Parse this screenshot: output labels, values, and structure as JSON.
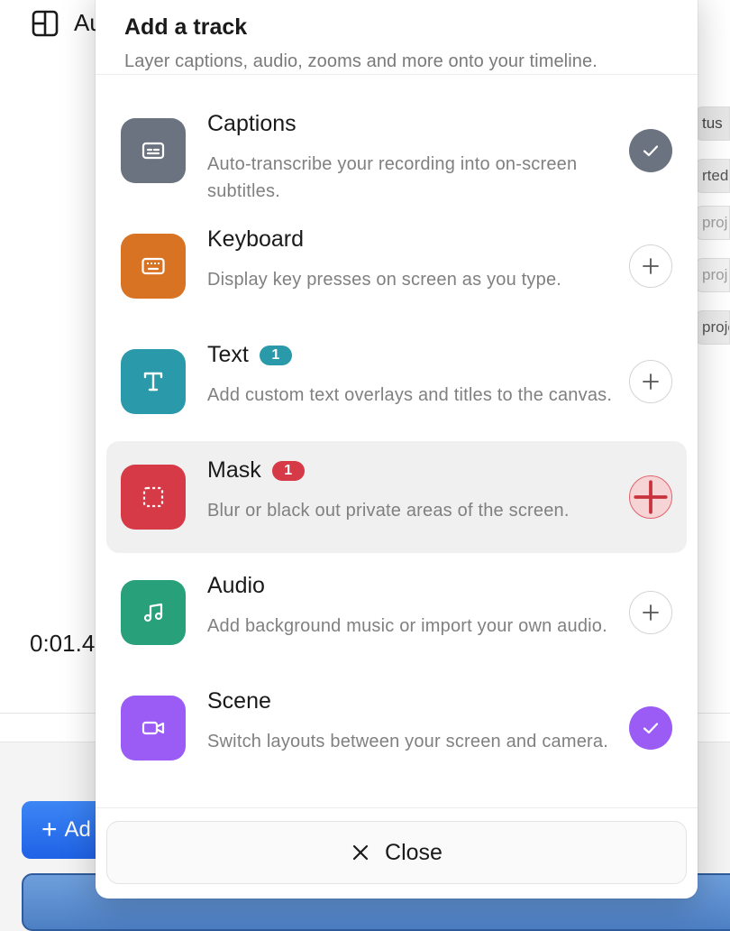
{
  "background": {
    "title_fragment": "Au",
    "time_fragment": "0:01.4",
    "add_button_fragment": "Ad",
    "chips": [
      "tus",
      "rted",
      "proj",
      "proj",
      "proje"
    ]
  },
  "modal": {
    "title": "Add a track",
    "subtitle": "Layer captions, audio, zooms and more onto your timeline.",
    "tracks": [
      {
        "name": "Captions",
        "description": "Auto-transcribe your recording into on-screen subtitles.",
        "icon": "captions-icon",
        "color": "#6b7280",
        "state": "added",
        "badge": ""
      },
      {
        "name": "Keyboard",
        "description": "Display key presses on screen as you type.",
        "icon": "keyboard-icon",
        "color": "#d97324",
        "state": "add",
        "badge": ""
      },
      {
        "name": "Text",
        "description": "Add custom text overlays and titles to the canvas.",
        "icon": "text-icon",
        "color": "#2a9aab",
        "state": "add",
        "badge": "1"
      },
      {
        "name": "Mask",
        "description": "Blur or black out private areas of the screen.",
        "icon": "mask-icon",
        "color": "#d63a46",
        "state": "add-hover",
        "badge": "1"
      },
      {
        "name": "Audio",
        "description": "Add background music or import your own audio.",
        "icon": "music-icon",
        "color": "#28a07a",
        "state": "add",
        "badge": ""
      },
      {
        "name": "Scene",
        "description": "Switch layouts between your screen and camera.",
        "icon": "camera-icon",
        "color": "#9b5cf6",
        "state": "added",
        "badge": ""
      }
    ],
    "close_label": "Close"
  }
}
